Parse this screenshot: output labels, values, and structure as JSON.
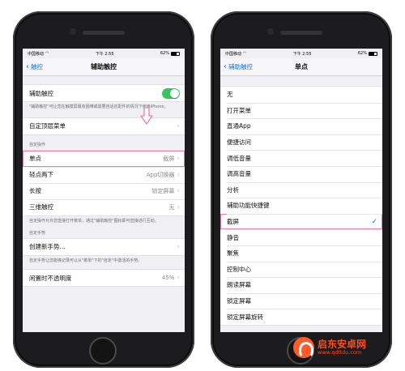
{
  "status_bar": {
    "carrier": "中国移动",
    "time": "下午 2:55",
    "battery": "62%"
  },
  "left": {
    "nav": {
      "back_label": "触控",
      "title": "辅助触控"
    },
    "assistive_touch_label": "辅助触控",
    "assistive_touch_on": true,
    "assistive_touch_note": "\"辅助触控\"可让您在触摸屏幕有困难或需要自适应配件的情况下使用iPhone。",
    "custom_top_menu": "自定顶层菜单",
    "custom_actions_header": "自定操作",
    "actions": [
      {
        "label": "单点",
        "value": "截屏"
      },
      {
        "label": "轻点两下",
        "value": "App切换器"
      },
      {
        "label": "长按",
        "value": "锁定屏幕"
      },
      {
        "label": "三维触控",
        "value": "无"
      }
    ],
    "actions_note": "自定操作允许您直接打开菜单，通过\"辅助触控\"图标即可直接进行互动。",
    "custom_gestures_header": "自定手势",
    "create_gesture": "创建新手势…",
    "gestures_note": "自定手势让您能够记录可以从\"菜单\"下的\"自定\"中激活的手势。",
    "idle_opacity_label": "闲置时不透明度",
    "idle_opacity_value": "45%"
  },
  "right": {
    "nav": {
      "back_label": "辅助触控",
      "title": "单点"
    },
    "options": [
      "无",
      "打开菜单",
      "直通App",
      "便捷访问",
      "调低音量",
      "调高音量",
      "分析",
      "辅助功能快捷键",
      "截屏",
      "静音",
      "聚焦",
      "控制中心",
      "朗读屏幕",
      "锁定屏幕",
      "锁定屏幕旋转"
    ],
    "selected": "截屏"
  },
  "watermark": {
    "name": "启东安卓网",
    "url": "www.qdltdu.com"
  },
  "colors": {
    "accent": "#1a73e8",
    "toggle": "#34c759",
    "highlight": "#f27ba5"
  }
}
